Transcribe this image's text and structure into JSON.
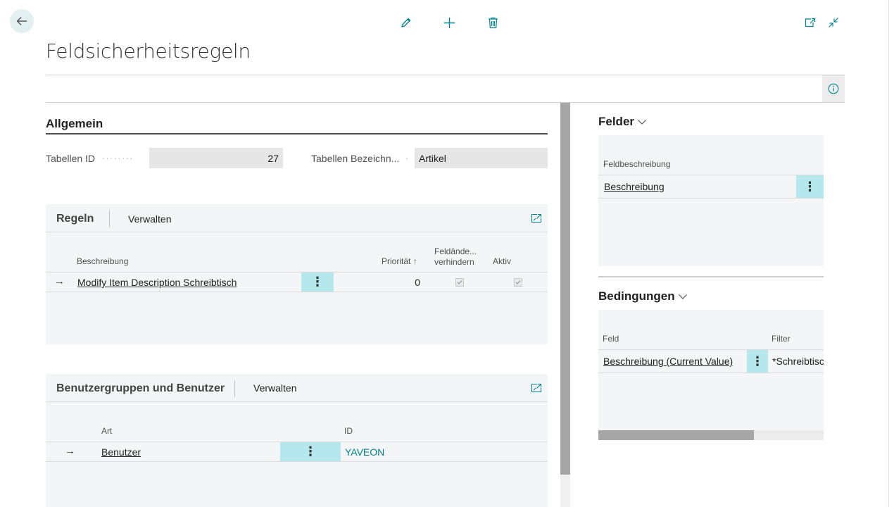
{
  "page": {
    "title": "Feldsicherheitsregeln"
  },
  "toolbar": {
    "back_icon": "arrow-left-icon",
    "edit_icon": "pencil-icon",
    "new_icon": "plus-icon",
    "delete_icon": "trash-icon",
    "open_new_window_icon": "open-in-new-window-icon",
    "collapse_icon": "collapse-icon",
    "info_icon": "info-icon"
  },
  "general": {
    "heading": "Allgemein",
    "table_id_label": "Tabellen ID",
    "table_id_value": "27",
    "table_name_label": "Tabellen Bezeichn...",
    "table_name_value": "Artikel"
  },
  "rules": {
    "heading": "Regeln",
    "action": "Verwalten",
    "columns": {
      "description": "Beschreibung",
      "priority": "Priorität",
      "prevent_line1": "Feldände...",
      "prevent_line2": "verhindern",
      "active": "Aktiv"
    },
    "rows": [
      {
        "description": "Modify Item Description Schreibtisch",
        "priority": "0",
        "prevent_change": true,
        "active": true
      }
    ]
  },
  "users": {
    "heading": "Benutzergruppen und Benutzer",
    "action": "Verwalten",
    "columns": {
      "type": "Art",
      "id": "ID"
    },
    "rows": [
      {
        "type": "Benutzer",
        "id": "YAVEON"
      }
    ]
  },
  "fields": {
    "heading": "Felder",
    "column": "Feldbeschreibung",
    "rows": [
      {
        "description": "Beschreibung"
      }
    ]
  },
  "conditions": {
    "heading": "Bedingungen",
    "columns": {
      "field": "Feld",
      "filter": "Filter"
    },
    "rows": [
      {
        "field": "Beschreibung (Current Value)",
        "filter": "*Schreibtisc"
      }
    ]
  },
  "colors": {
    "accent": "#00838f",
    "kebab_bg": "#b5e8ed",
    "part_bg": "#f4f5f6"
  }
}
